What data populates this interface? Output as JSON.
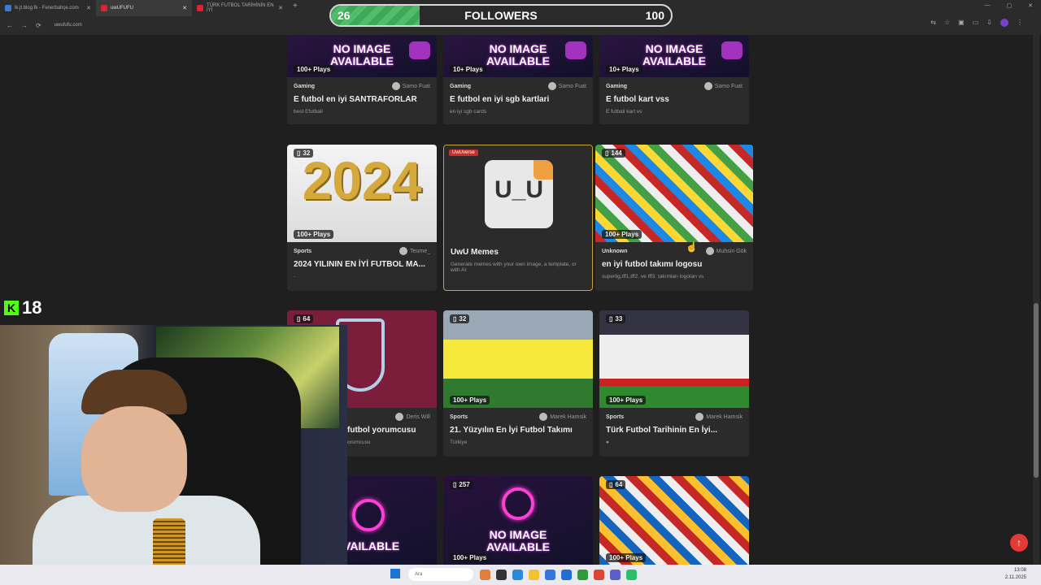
{
  "browser": {
    "tabs": [
      {
        "label": "lk.jt.blog.fk - Fenerbahçe.com",
        "active": false
      },
      {
        "label": "uwUFUFU",
        "active": true
      },
      {
        "label": "TÜRK FUTBOL TARİHİNİN EN İYİ",
        "active": false
      }
    ],
    "url": "uwufufu.com"
  },
  "overlay": {
    "followers_label": "FOLLOWERS",
    "followers_current": "26",
    "followers_goal": "100",
    "progress_fraction": 0.26,
    "kick_count": "18"
  },
  "cards": [
    {
      "id": "c1",
      "category": "Gaming",
      "author": "Samo Fuat",
      "title": "E futbol en iyi SANTRAFORLAR",
      "desc": "best Efutball",
      "plays": "100+ Plays",
      "count": "",
      "thumb": "noimg"
    },
    {
      "id": "c2",
      "category": "Gaming",
      "author": "Samo Fuat",
      "title": "E futbol en iyi sgb kartlari",
      "desc": "en iyi sgb cards",
      "plays": "10+ Plays",
      "count": "",
      "thumb": "noimg"
    },
    {
      "id": "c3",
      "category": "Gaming",
      "author": "Samo Fuat",
      "title": "E futbol kart vss",
      "desc": "E futbali kart vs",
      "plays": "10+ Plays",
      "count": "",
      "thumb": "noimg"
    },
    {
      "id": "c4",
      "category": "Sports",
      "author": "Teume_",
      "title": "2024 YILININ EN İYİ FUTBOL MA...",
      "desc": "-",
      "plays": "100+ Plays",
      "count": "32",
      "thumb": "2024"
    },
    {
      "id": "c5",
      "category": "",
      "author": "",
      "title": "UwU Memes",
      "desc": "Generate memes with your own image, a template, or with AI",
      "plays": "",
      "count": "",
      "tag": "UwUverse",
      "thumb": "uwu"
    },
    {
      "id": "c6",
      "category": "Unknown",
      "author": "Muhsin Gök",
      "title": "en iyi futbol takımı logosu",
      "desc": "superlig,tff1,tff2. ve tff3. takımları logoları vs",
      "plays": "100+ Plays",
      "count": "144",
      "thumb": "sticker"
    },
    {
      "id": "c7",
      "category": "",
      "author": "Deris Will",
      "title": "futbol yorumcusu",
      "desc": "orumcusu",
      "plays": "",
      "count": "64",
      "thumb": "tsfc"
    },
    {
      "id": "c8",
      "category": "Sports",
      "author": "Marek Hamsik",
      "title": "21. Yüzyılın En İyi Futbol Takımı",
      "desc": "Türkiye",
      "plays": "100+ Plays",
      "count": "32",
      "thumb": "team1"
    },
    {
      "id": "c9",
      "category": "Sports",
      "author": "Marek Hamsik",
      "title": "Türk Futbol Tarihinin En İyi...",
      "desc": "●",
      "plays": "100+ Plays",
      "count": "33",
      "thumb": "team2"
    },
    {
      "id": "c10",
      "category": "",
      "author": "",
      "title": "",
      "desc": "",
      "plays": "",
      "count": "",
      "thumb": "neon"
    },
    {
      "id": "c11",
      "category": "",
      "author": "",
      "title": "",
      "desc": "",
      "plays": "100+ Plays",
      "count": "257",
      "thumb": "neon2"
    },
    {
      "id": "c12",
      "category": "",
      "author": "",
      "title": "",
      "desc": "",
      "plays": "100+ Plays",
      "count": "64",
      "thumb": "sticker2"
    }
  ],
  "noimage_text": [
    "NO IMAGE",
    "AVAILABLE"
  ],
  "year_text": "2024",
  "uwu_face": "U_U",
  "taskbar": {
    "search_placeholder": "Ara",
    "time": "13:08",
    "date": "2.11.2025"
  },
  "colors": {
    "accent": "#e53935",
    "progress": "#3ea85a",
    "kick": "#53fc18"
  },
  "icons": {
    "scroll_up": "arrow-up-icon"
  }
}
